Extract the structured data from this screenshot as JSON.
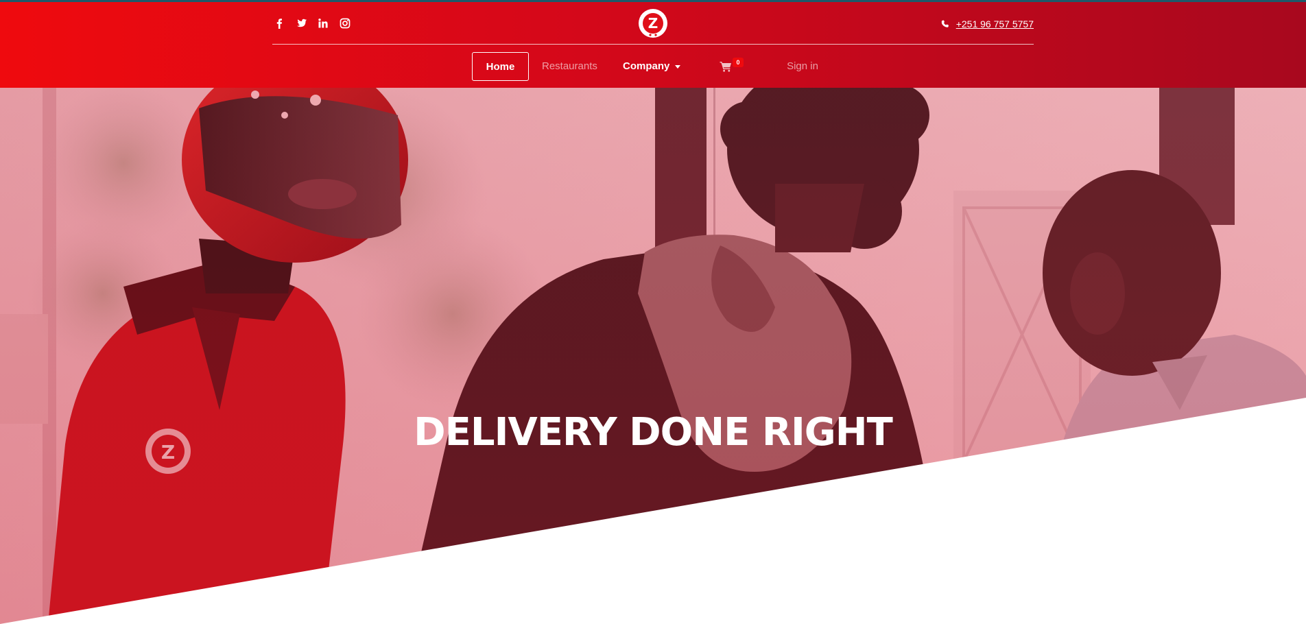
{
  "header": {
    "social": [
      {
        "icon": "facebook-icon"
      },
      {
        "icon": "twitter-icon"
      },
      {
        "icon": "linkedin-icon"
      },
      {
        "icon": "instagram-icon"
      }
    ],
    "logo_letter": "Z",
    "phone": "+251 96 757 5757"
  },
  "nav": {
    "home": "Home",
    "restaurants": "Restaurants",
    "company": "Company",
    "cart_count": "0",
    "sign_in": "Sign in"
  },
  "hero": {
    "title": "DELIVERY DONE RIGHT"
  },
  "colors": {
    "brand_red": "#ef0a0e",
    "brand_dark_red": "#a8081e",
    "accent_line": "#1d5a6a"
  }
}
